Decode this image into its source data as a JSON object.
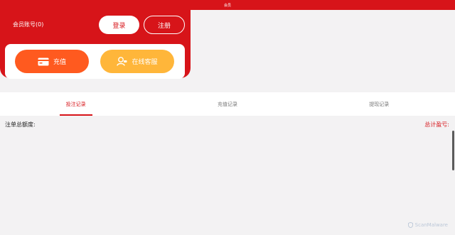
{
  "topbar": {
    "title": "会员"
  },
  "header": {
    "account_label": "会员账号(0)",
    "login_label": "登录",
    "register_label": "注册"
  },
  "actions": {
    "recharge_label": "充值",
    "support_label": "在线客服",
    "recharge_color": "#ff5a1f",
    "support_color": "#ffb63a",
    "recharge_icon": "card-icon",
    "support_icon": "support-icon"
  },
  "tabs": [
    {
      "label": "投注记录",
      "active": true
    },
    {
      "label": "充值记录",
      "active": false
    },
    {
      "label": "提现记录",
      "active": false
    }
  ],
  "list": {
    "left_label": "注单总额度:",
    "right_label": "总计盈亏:"
  },
  "watermark": {
    "text": "ScanMalware"
  },
  "colors": {
    "brand": "#d71419",
    "background": "#f3f2f3"
  }
}
